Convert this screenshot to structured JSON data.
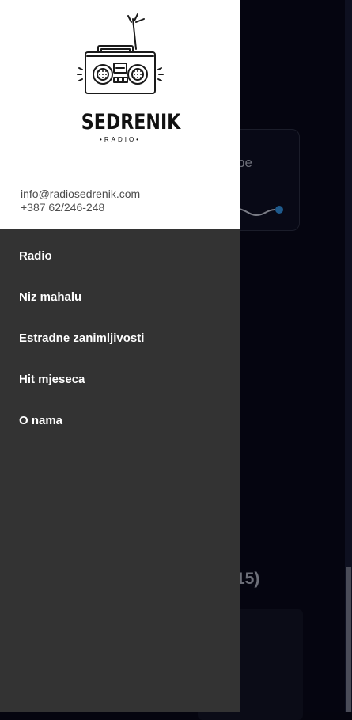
{
  "background": {
    "card_text": "pe",
    "count_text": "15)"
  },
  "drawer": {
    "logo": {
      "title": "SEDRENIK",
      "subtitle": "•RADIO•"
    },
    "contact": {
      "email": "info@radiosedrenik.com",
      "phone": "+387 62/246-248"
    },
    "menu": [
      {
        "label": "Radio"
      },
      {
        "label": "Niz mahalu"
      },
      {
        "label": "Estradne zanimljivosti"
      },
      {
        "label": "Hit mjeseca"
      },
      {
        "label": "O nama"
      }
    ]
  },
  "colors": {
    "drawer_bg": "#333333",
    "header_bg": "#ffffff",
    "app_bg": "#050510",
    "accent": "#1e5a8c"
  }
}
